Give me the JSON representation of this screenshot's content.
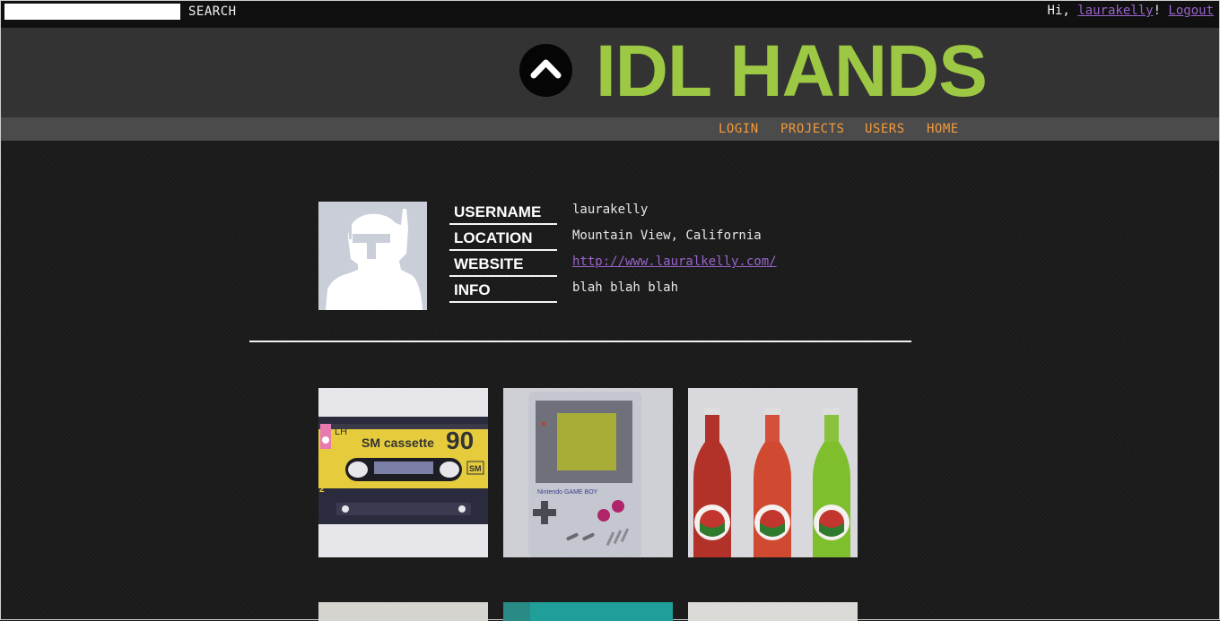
{
  "topbar": {
    "search_placeholder": "",
    "search_label": "SEARCH",
    "greeting_prefix": "Hi, ",
    "username": "laurakelly",
    "greeting_suffix": "! ",
    "logout_label": "Logout"
  },
  "header": {
    "title": "IDL HANDS"
  },
  "nav": {
    "items": [
      "LOGIN",
      "PROJECTS",
      "USERS",
      "HOME"
    ]
  },
  "profile": {
    "fields": [
      {
        "label": "USERNAME",
        "value": "laurakelly"
      },
      {
        "label": "LOCATION",
        "value": "Mountain View, California"
      },
      {
        "label": "WEBSITE",
        "value": "http://www.lauralkelly.com/"
      },
      {
        "label": "INFO",
        "value": "blah blah blah"
      }
    ]
  },
  "projects": {
    "items": [
      {
        "name": "cassette-thumbnail",
        "label_text": [
          "LH",
          "SM cassette",
          "90",
          "SM",
          "2"
        ]
      },
      {
        "name": "gameboy-thumbnail",
        "label_text": [
          "Nintendo GAME BOY"
        ]
      },
      {
        "name": "soda-bottles-thumbnail"
      },
      {
        "name": "project-thumbnail-4"
      },
      {
        "name": "project-thumbnail-5"
      },
      {
        "name": "project-thumbnail-6"
      }
    ]
  },
  "colors": {
    "accent_green": "#9dc844",
    "nav_orange": "#f39a3a",
    "link_purple": "#9a63cc",
    "header_bg": "#333333",
    "nav_bg": "#4b4b4b"
  }
}
